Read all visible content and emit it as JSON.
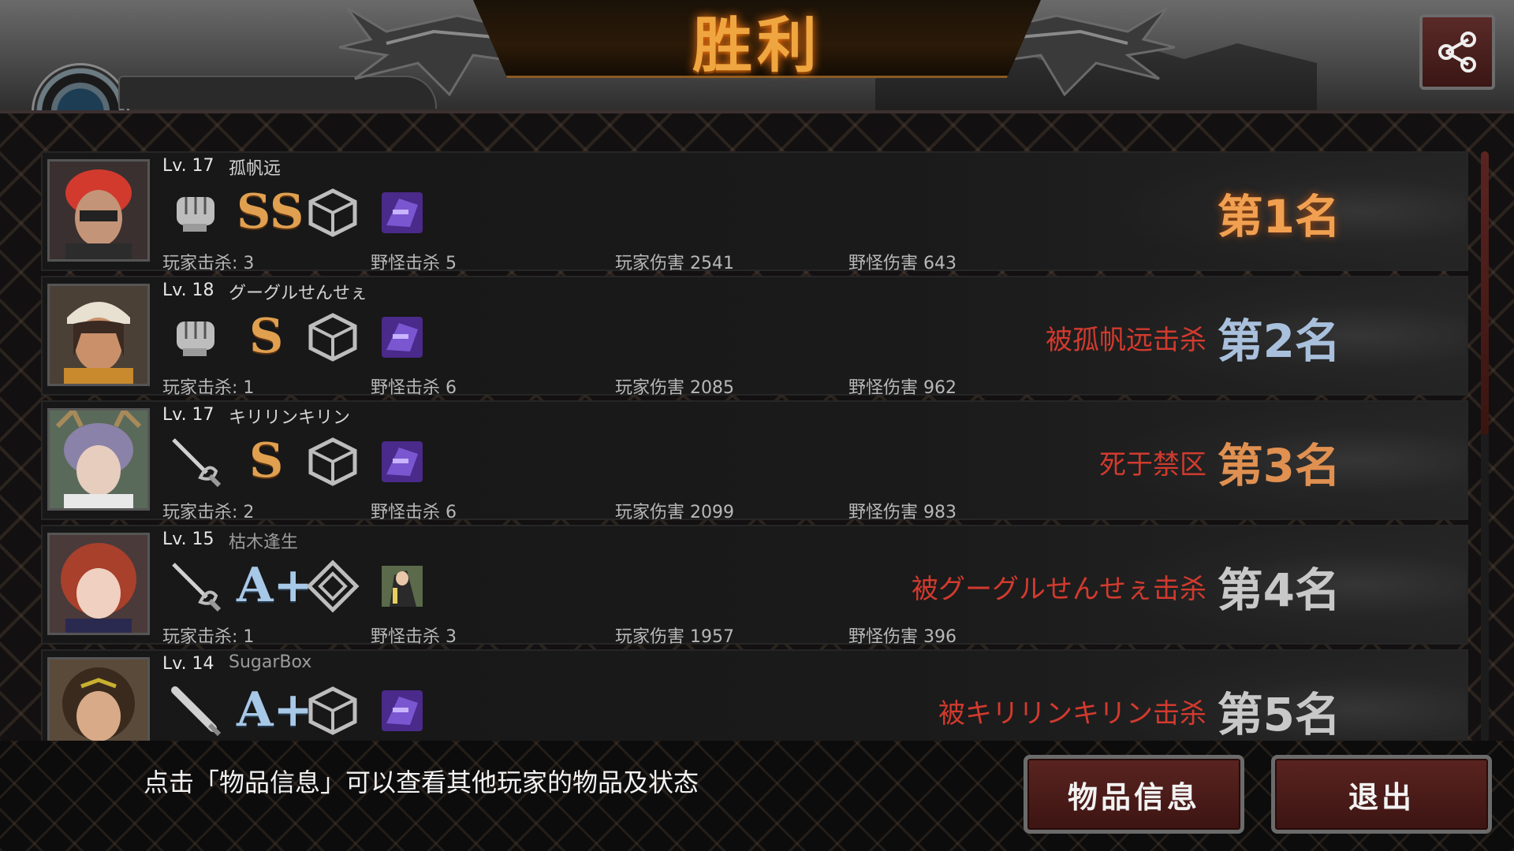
{
  "header": {
    "title": "胜利",
    "tab_label": ""
  },
  "players": [
    {
      "level": "Lv. 17",
      "name": "孤帆远",
      "weapon_icon": "fist-icon",
      "grade": "SS",
      "armor_icon": "armor-grid-icon",
      "item_icon": "purple-gear-icon",
      "player_kills": "玩家击杀: 3",
      "monster_kills": "野怪击杀 5",
      "player_damage": "玩家伤害 2541",
      "monster_damage": "野怪伤害 643",
      "fate": "",
      "rank": "第1名"
    },
    {
      "level": "Lv. 18",
      "name": "グーグルせんせぇ",
      "weapon_icon": "fist-icon",
      "grade": "S",
      "armor_icon": "armor-grid-icon",
      "item_icon": "purple-gear-icon",
      "player_kills": "玩家击杀: 1",
      "monster_kills": "野怪击杀 6",
      "player_damage": "玩家伤害 2085",
      "monster_damage": "野怪伤害 962",
      "fate": "被孤帆远击杀",
      "rank": "第2名"
    },
    {
      "level": "Lv. 17",
      "name": "キリリンキリン",
      "weapon_icon": "rapier-icon",
      "grade": "S",
      "armor_icon": "armor-grid-icon",
      "item_icon": "purple-gear-icon",
      "player_kills": "玩家击杀: 2",
      "monster_kills": "野怪击杀 6",
      "player_damage": "玩家伤害 2099",
      "monster_damage": "野怪伤害 983",
      "fate": "死于禁区",
      "rank": "第3名"
    },
    {
      "level": "Lv. 15",
      "name": "枯木逢生",
      "weapon_icon": "rapier-icon",
      "grade": "A+",
      "armor_icon": "armor-diamond-icon",
      "item_icon": "character-card-icon",
      "player_kills": "玩家击杀: 1",
      "monster_kills": "野怪击杀 3",
      "player_damage": "玩家伤害 1957",
      "monster_damage": "野怪伤害 396",
      "fate": "被グーグルせんせぇ击杀",
      "rank": "第4名"
    },
    {
      "level": "Lv. 14",
      "name": "SugarBox",
      "weapon_icon": "bat-icon",
      "grade": "A+",
      "armor_icon": "armor-grid-icon",
      "item_icon": "purple-gear-icon",
      "player_kills": "",
      "monster_kills": "",
      "player_damage": "",
      "monster_damage": "",
      "fate": "被キリリンキリン击杀",
      "rank": "第5名"
    }
  ],
  "footer": {
    "hint": "点击「物品信息」可以查看其他玩家的物品及状态",
    "items_button": "物品信息",
    "exit_button": "退出"
  },
  "colors": {
    "title_gold": "#f0a640",
    "fate_red": "#d23a2e",
    "button_red": "#5a2420"
  }
}
